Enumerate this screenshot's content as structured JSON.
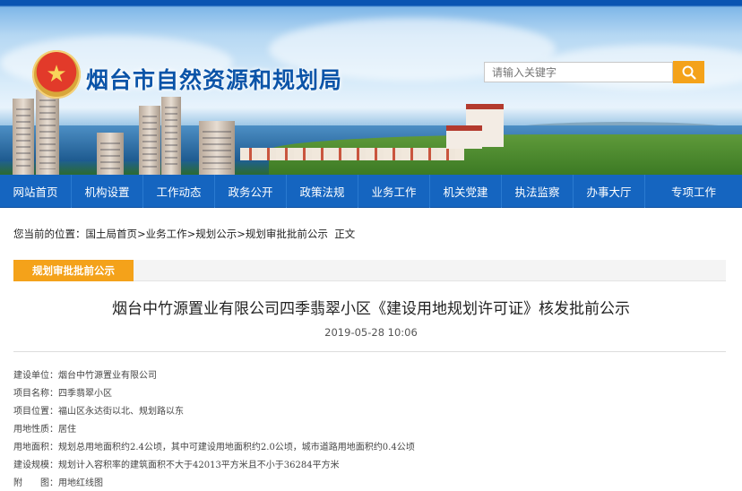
{
  "header": {
    "site_title": "烟台市自然资源和规划局",
    "search_placeholder": "请输入关键字",
    "search_icon": "search-icon",
    "emblem_icon": "national-emblem-icon"
  },
  "colors": {
    "nav_bg": "#1565c0",
    "accent_orange": "#f4a21a",
    "title_blue": "#0b54a8"
  },
  "nav": {
    "items": [
      {
        "label": "网站首页"
      },
      {
        "label": "机构设置"
      },
      {
        "label": "工作动态"
      },
      {
        "label": "政务公开"
      },
      {
        "label": "政策法规"
      },
      {
        "label": "业务工作"
      },
      {
        "label": "机关党建"
      },
      {
        "label": "执法监察"
      },
      {
        "label": "办事大厅"
      },
      {
        "label": "专项工作"
      }
    ]
  },
  "breadcrumb": {
    "prefix": "您当前的位置：",
    "items": [
      "国土局首页",
      "业务工作",
      "规划公示",
      "规划审批批前公示"
    ],
    "separator": ">",
    "current": "正文"
  },
  "section": {
    "tag": "规划审批批前公示"
  },
  "article": {
    "title": "烟台中竹源置业有限公司四季翡翠小区《建设用地规划许可证》核发批前公示",
    "date": "2019-05-28 10:06",
    "details": [
      {
        "label": "建设单位：",
        "value": "烟台中竹源置业有限公司"
      },
      {
        "label": "项目名称：",
        "value": "四季翡翠小区"
      },
      {
        "label": "项目位置：",
        "value": "福山区永达街以北、规划路以东"
      },
      {
        "label": "用地性质：",
        "value": "居住"
      },
      {
        "label": "用地面积：",
        "value": "规划总用地面积约2.4公顷，其中可建设用地面积约2.0公顷，城市道路用地面积约0.4公顷"
      },
      {
        "label": "建设规模：",
        "value": "规划计入容积率的建筑面积不大于42013平方米且不小于36284平方米"
      },
      {
        "label": "附　　图：",
        "value": "用地红线图"
      }
    ]
  }
}
